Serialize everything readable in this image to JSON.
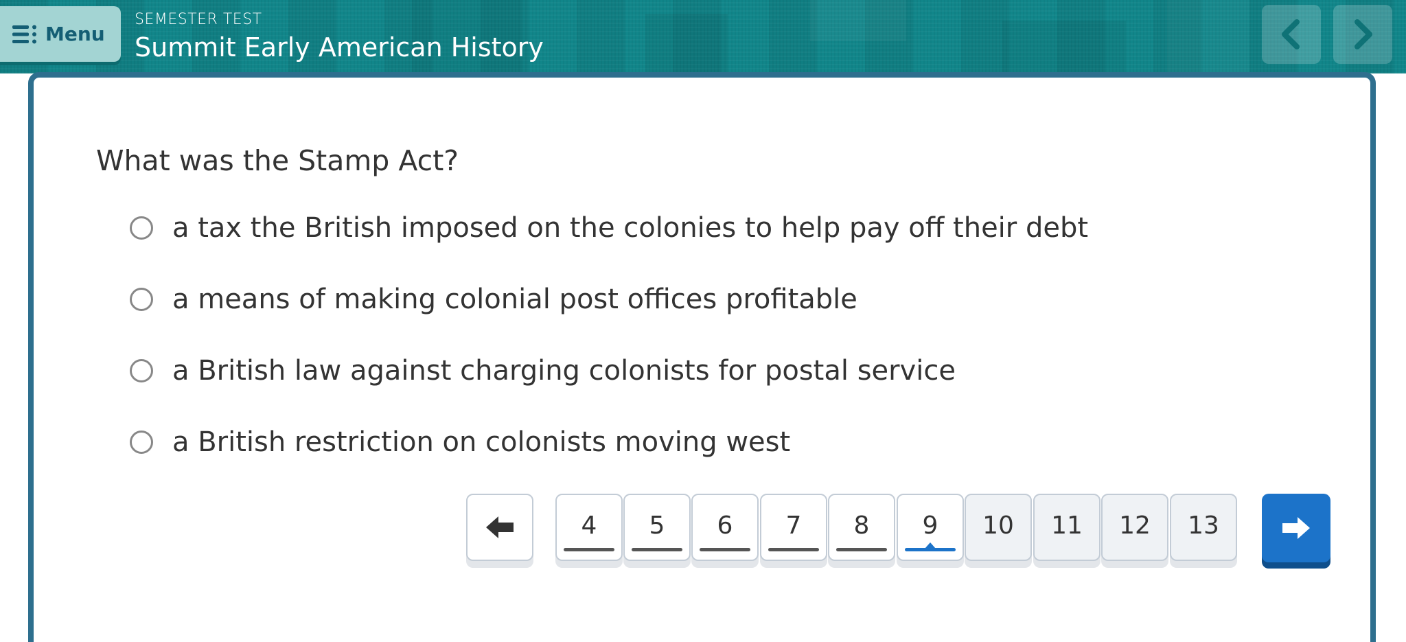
{
  "header": {
    "menu_label": "Menu",
    "subtitle": "SEMESTER TEST",
    "title": "Summit Early American History",
    "prev_icon": "chevron-left-icon",
    "next_icon": "chevron-right-icon"
  },
  "question": {
    "text": "What was the Stamp Act?",
    "options": [
      "a tax the British imposed on the colonies to help pay off their debt",
      "a means of making colonial post offices profitable",
      "a British law against charging colonists for postal service",
      "a British restriction on colonists moving west"
    ]
  },
  "pagination": {
    "prev_icon": "arrow-left-icon",
    "pages": [
      {
        "label": "4",
        "state": "visited"
      },
      {
        "label": "5",
        "state": "visited"
      },
      {
        "label": "6",
        "state": "visited"
      },
      {
        "label": "7",
        "state": "visited"
      },
      {
        "label": "8",
        "state": "visited"
      },
      {
        "label": "9",
        "state": "current"
      },
      {
        "label": "10",
        "state": "unvisited"
      },
      {
        "label": "11",
        "state": "unvisited"
      },
      {
        "label": "12",
        "state": "unvisited"
      },
      {
        "label": "13",
        "state": "unvisited"
      }
    ],
    "next_icon": "arrow-right-icon"
  },
  "colors": {
    "header_teal": "#11868a",
    "menu_button": "#a3d4d3",
    "card_border": "#2e6f8e",
    "accent_blue": "#1c73c9"
  }
}
